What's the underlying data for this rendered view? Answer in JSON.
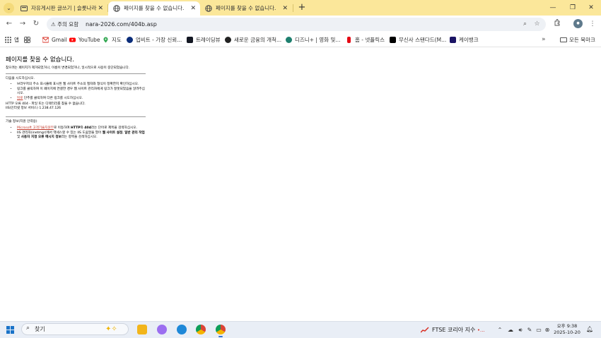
{
  "tabs": [
    {
      "title": "자유게시판 글쓰기 | 슬롯나라",
      "active": false
    },
    {
      "title": "페이지를 찾을 수 없습니다.",
      "active": true
    },
    {
      "title": "페이지를 찾을 수 없습니다.",
      "active": false
    }
  ],
  "window_controls": {
    "minimize": "—",
    "restore": "❐",
    "close": "✕"
  },
  "toolbar": {
    "security_label": "주의 요함",
    "url": "nara-2026.com/404b.asp"
  },
  "bookmarks": [
    {
      "label": "앱",
      "color": "#555555"
    },
    {
      "label": "",
      "color": "#555555"
    },
    {
      "label": "Gmail",
      "color": "#d93025"
    },
    {
      "label": "YouTube",
      "color": "#ff0000"
    },
    {
      "label": "지도",
      "color": "#34a853"
    },
    {
      "label": "업비트 - 가장 신뢰...",
      "color": "#0b2d7a"
    },
    {
      "label": "트레이딩뷰",
      "color": "#131722"
    },
    {
      "label": "새로운 금융의 개척...",
      "color": "#222222"
    },
    {
      "label": "디즈니+ | 영화 및...",
      "color": "#1e7f6e"
    },
    {
      "label": "홈 - 넷플릭스",
      "color": "#e50914"
    },
    {
      "label": "무신사 스탠다드(M...",
      "color": "#000000"
    },
    {
      "label": "케이뱅크",
      "color": "#1b1464"
    }
  ],
  "bookmarks_more": "»",
  "bookmarks_all": "모든 북마크",
  "page": {
    "title": "페이지를 찾을 수 없습니다.",
    "intro": "찾으려는 페이지가 제거되었거나, 이름이 변경되었거나, 일시적으로 사용이 중단되었습니다.",
    "try_heading": "다음을 시도하십시오.",
    "try_item1": "브라우저의 주소 표시줄에 표시된 웹 사이트 주소의 철자와 형식이 정확한지 확인하십시오.",
    "try_item2": "링크를 클릭하여 이 페이지에 연결한 경우 웹 사이트 관리자에게 링크가 잘못되었음을 알려주십시오.",
    "try_item3_link": "뒤로",
    "try_item3_rest": " 단추를 클릭하여 다른 링크를 시도하십시오.",
    "http_error": "HTTP 오류 404 - 파일 또는 디렉터리를 찾을 수 없습니다.",
    "iis_info": "IIS(인터넷 정보 서비스) 1.238.47.126",
    "tech_heading": "기술 정보(지원 인력용)",
    "tech_item1_link": "Microsoft 고객기술지원부",
    "tech_item1_a": "로 이동하여 ",
    "tech_item1_b1": "HTTP",
    "tech_item1_c": "와 ",
    "tech_item1_b2": "404",
    "tech_item1_d": "라는 단어로 제목을 검색하십시오.",
    "tech_item2_a": "IIS 관리자(inetmgr)에서 액세스할 수 있는 IIS 도움말을 열어 ",
    "tech_item2_b1": "웹 사이트 설정",
    "tech_item2_c": ", ",
    "tech_item2_b2": "일반 관리 작업",
    "tech_item2_d": " 및 ",
    "tech_item2_b3": "사용자 지정 오류 메시지 정보",
    "tech_item2_e": "라는 항목을 검색하십시오."
  },
  "taskbar": {
    "search_placeholder": "찾기",
    "stock_label": "FTSE 코리아 지수",
    "stock_dot": "•...",
    "clock_time": "오후 9:38",
    "clock_date": "2025-10-20"
  }
}
